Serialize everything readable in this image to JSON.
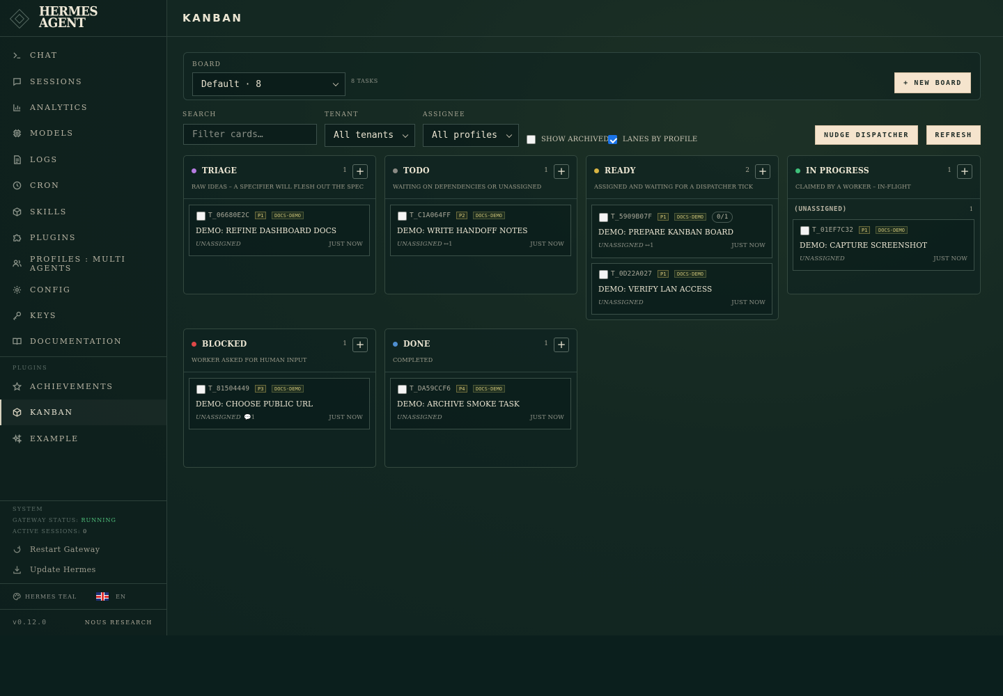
{
  "sidebar": {
    "brand_line1": "HERMES",
    "brand_line2": "AGENT",
    "nav": [
      {
        "label": "CHAT",
        "icon": "terminal-icon"
      },
      {
        "label": "SESSIONS",
        "icon": "chat-bubble-icon"
      },
      {
        "label": "ANALYTICS",
        "icon": "bar-chart-icon"
      },
      {
        "label": "MODELS",
        "icon": "cpu-icon"
      },
      {
        "label": "LOGS",
        "icon": "document-icon"
      },
      {
        "label": "CRON",
        "icon": "clock-icon"
      },
      {
        "label": "SKILLS",
        "icon": "package-icon"
      },
      {
        "label": "PLUGINS",
        "icon": "puzzle-icon"
      },
      {
        "label": "PROFILES : MULTI AGENTS",
        "icon": "users-icon"
      },
      {
        "label": "CONFIG",
        "icon": "gear-icon"
      },
      {
        "label": "KEYS",
        "icon": "key-icon"
      },
      {
        "label": "DOCUMENTATION",
        "icon": "book-icon"
      }
    ],
    "plugins_label": "PLUGINS",
    "plugin_nav": [
      {
        "label": "ACHIEVEMENTS",
        "icon": "star-icon"
      },
      {
        "label": "KANBAN",
        "icon": "package-icon",
        "active": true
      },
      {
        "label": "EXAMPLE",
        "icon": "sparkle-icon"
      }
    ],
    "system": {
      "label": "SYSTEM",
      "gateway_label": "GATEWAY STATUS:",
      "gateway_value": "RUNNING",
      "sessions_label": "ACTIVE SESSIONS:",
      "sessions_value": "0",
      "restart": "Restart Gateway",
      "update": "Update Hermes"
    },
    "theme": "HERMES TEAL",
    "language": "EN",
    "version": "v0.12.0",
    "footer_brand": "NOUS RESEARCH"
  },
  "header": {
    "title": "KANBAN"
  },
  "board": {
    "label": "BOARD",
    "selected": "Default · 8",
    "task_count": "8 TASKS",
    "new_board": "+ NEW BOARD"
  },
  "filters": {
    "search_label": "SEARCH",
    "search_placeholder": "Filter cards…",
    "tenant_label": "TENANT",
    "tenant_value": "All tenants",
    "assignee_label": "ASSIGNEE",
    "assignee_value": "All profiles",
    "show_archived": "SHOW ARCHIVED",
    "lanes_by_profile": "LANES BY PROFILE",
    "nudge": "NUDGE DISPATCHER",
    "refresh": "REFRESH"
  },
  "columns": {
    "triage": {
      "title": "TRIAGE",
      "count": "1",
      "color": "#b57be0",
      "subtitle": "RAW IDEAS – A SPECIFIER WILL FLESH OUT THE SPEC",
      "cards": [
        {
          "id": "T_06680E2C",
          "priority": "P1",
          "tag": "DOCS-DEMO",
          "title": "DEMO: REFINE DASHBOARD DOCS",
          "assignee": "UNASSIGNED",
          "time": "JUST NOW"
        }
      ]
    },
    "todo": {
      "title": "TODO",
      "count": "1",
      "color": "#8a8a84",
      "subtitle": "WAITING ON DEPENDENCIES OR UNASSIGNED",
      "cards": [
        {
          "id": "T_C1A064FF",
          "priority": "P2",
          "tag": "DOCS-DEMO",
          "title": "DEMO: WRITE HANDOFF NOTES",
          "assignee": "UNASSIGNED",
          "meta": "↔1",
          "time": "JUST NOW"
        }
      ]
    },
    "ready": {
      "title": "READY",
      "count": "2",
      "color": "#d9b443",
      "subtitle": "ASSIGNED AND WAITING FOR A DISPATCHER TICK",
      "cards": [
        {
          "id": "T_5909B07F",
          "priority": "P1",
          "tag": "DOCS-DEMO",
          "progress": "0/1",
          "title": "DEMO: PREPARE KANBAN BOARD",
          "assignee": "UNASSIGNED",
          "meta": "↔1",
          "time": "JUST NOW"
        },
        {
          "id": "T_0D22A027",
          "priority": "P1",
          "tag": "DOCS-DEMO",
          "title": "DEMO: VERIFY LAN ACCESS",
          "assignee": "UNASSIGNED",
          "time": "JUST NOW"
        }
      ]
    },
    "in_progress": {
      "title": "IN PROGRESS",
      "count": "1",
      "color": "#3fc07a",
      "subtitle": "CLAIMED BY A WORKER – IN-FLIGHT",
      "lane_label": "(UNASSIGNED)",
      "lane_count": "1",
      "cards": [
        {
          "id": "T_01EF7C32",
          "priority": "P1",
          "tag": "DOCS-DEMO",
          "title": "DEMO: CAPTURE SCREENSHOT",
          "assignee": "UNASSIGNED",
          "time": "JUST NOW"
        }
      ]
    },
    "blocked": {
      "title": "BLOCKED",
      "count": "1",
      "color": "#e04848",
      "subtitle": "WORKER ASKED FOR HUMAN INPUT",
      "cards": [
        {
          "id": "T_81504449",
          "priority": "P3",
          "tag": "DOCS-DEMO",
          "title": "DEMO: CHOOSE PUBLIC URL",
          "assignee": "UNASSIGNED",
          "meta": "💬1",
          "time": "JUST NOW"
        }
      ]
    },
    "done": {
      "title": "DONE",
      "count": "1",
      "color": "#4f8fd0",
      "subtitle": "COMPLETED",
      "cards": [
        {
          "id": "T_DA59CCF6",
          "priority": "P4",
          "tag": "DOCS-DEMO",
          "title": "DEMO: ARCHIVE SMOKE TASK",
          "assignee": "UNASSIGNED",
          "time": "JUST NOW"
        }
      ]
    }
  }
}
